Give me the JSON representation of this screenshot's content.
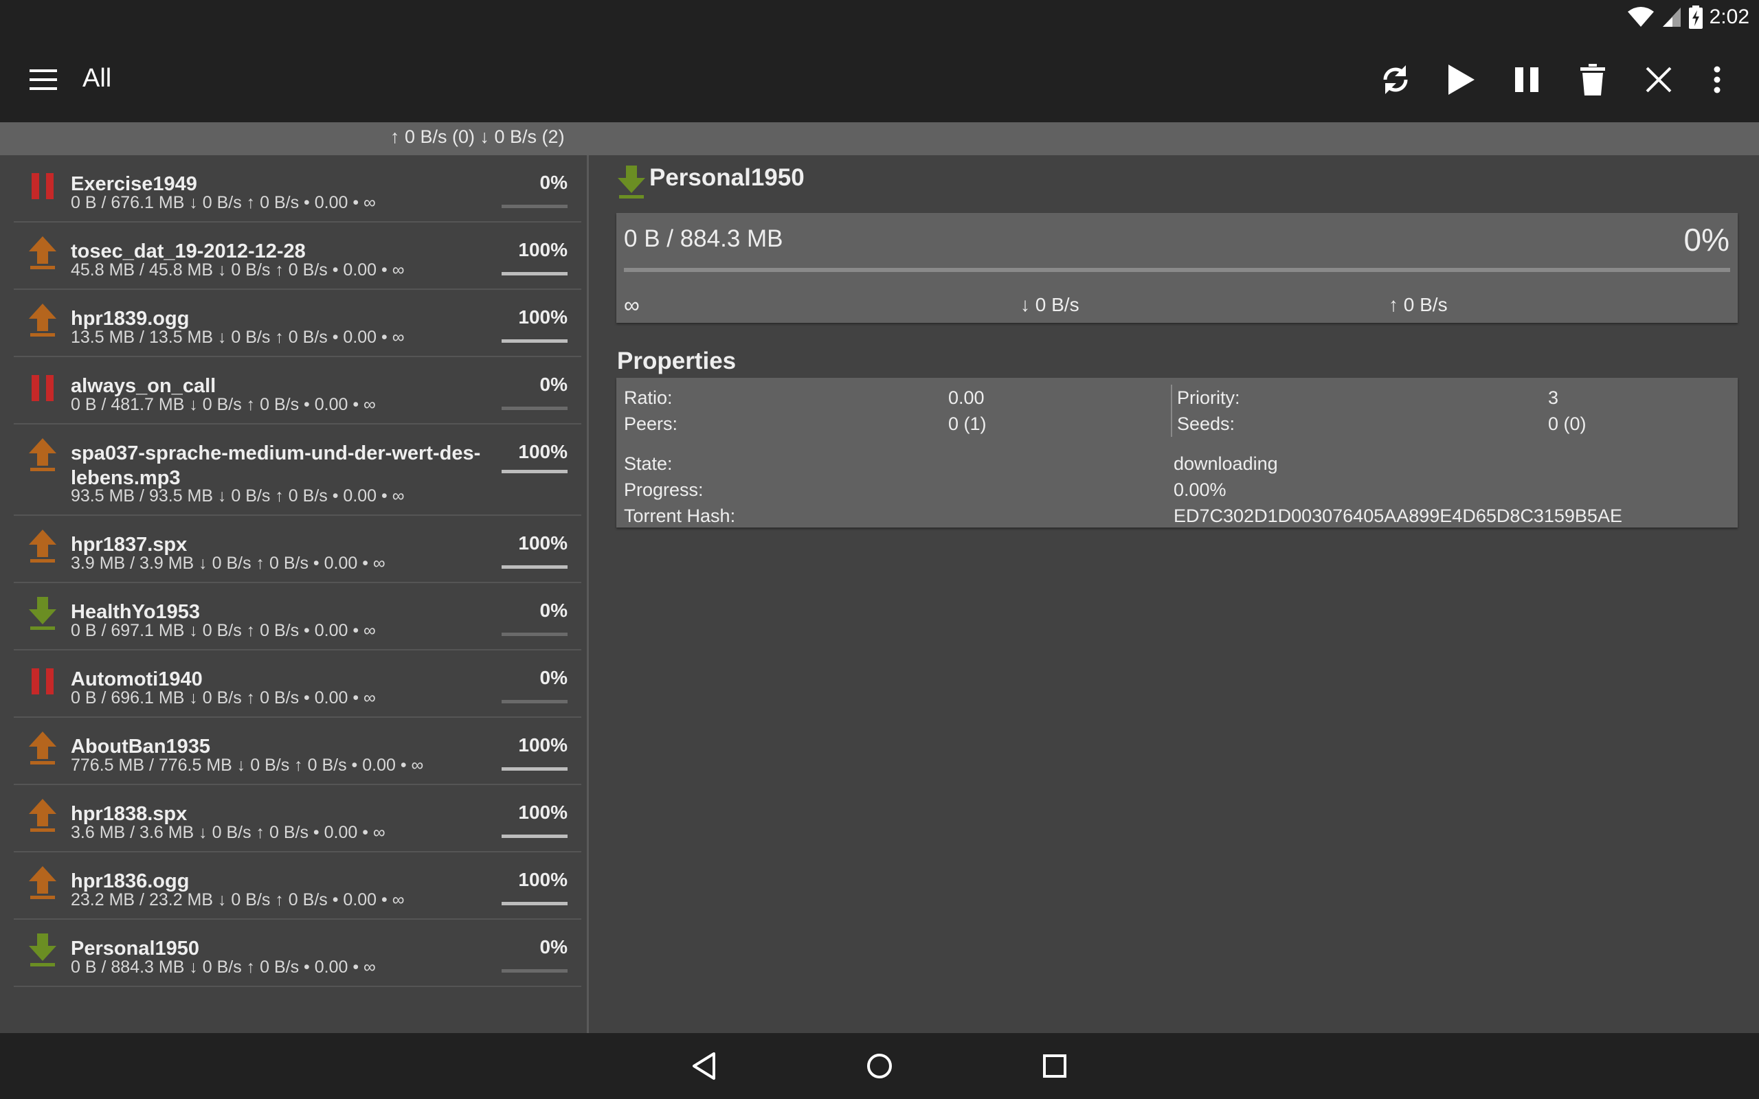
{
  "status": {
    "time": "2:02"
  },
  "toolbar": {
    "title": "All"
  },
  "speed": {
    "summary": "↑ 0 B/s (0) ↓ 0 B/s (2)"
  },
  "torrents": [
    {
      "name": "Exercise1949",
      "meta": "0 B / 676.1 MB ↓ 0 B/s ↑ 0 B/s • 0.00 • ∞",
      "percent": "0%",
      "progress": 0,
      "state": "paused"
    },
    {
      "name": "tosec_dat_19-2012-12-28",
      "meta": "45.8 MB / 45.8 MB ↓ 0 B/s ↑ 0 B/s • 0.00 • ∞",
      "percent": "100%",
      "progress": 100,
      "state": "seeding"
    },
    {
      "name": "hpr1839.ogg",
      "meta": "13.5 MB / 13.5 MB ↓ 0 B/s ↑ 0 B/s • 0.00 • ∞",
      "percent": "100%",
      "progress": 100,
      "state": "seeding"
    },
    {
      "name": "always_on_call",
      "meta": "0 B / 481.7 MB ↓ 0 B/s ↑ 0 B/s • 0.00 • ∞",
      "percent": "0%",
      "progress": 0,
      "state": "paused"
    },
    {
      "name": "spa037-sprache-medium-und-der-wert-des-lebens.mp3",
      "meta": "93.5 MB / 93.5 MB ↓ 0 B/s ↑ 0 B/s • 0.00 • ∞",
      "percent": "100%",
      "progress": 100,
      "state": "seeding"
    },
    {
      "name": "hpr1837.spx",
      "meta": "3.9 MB / 3.9 MB ↓ 0 B/s ↑ 0 B/s • 0.00 • ∞",
      "percent": "100%",
      "progress": 100,
      "state": "seeding"
    },
    {
      "name": "HealthYo1953",
      "meta": "0 B / 697.1 MB ↓ 0 B/s ↑ 0 B/s • 0.00 • ∞",
      "percent": "0%",
      "progress": 0,
      "state": "downloading"
    },
    {
      "name": "Automoti1940",
      "meta": "0 B / 696.1 MB ↓ 0 B/s ↑ 0 B/s • 0.00 • ∞",
      "percent": "0%",
      "progress": 0,
      "state": "paused"
    },
    {
      "name": "AboutBan1935",
      "meta": "776.5 MB / 776.5 MB ↓ 0 B/s ↑ 0 B/s • 0.00 • ∞",
      "percent": "100%",
      "progress": 100,
      "state": "seeding"
    },
    {
      "name": "hpr1838.spx",
      "meta": "3.6 MB / 3.6 MB ↓ 0 B/s ↑ 0 B/s • 0.00 • ∞",
      "percent": "100%",
      "progress": 100,
      "state": "seeding"
    },
    {
      "name": "hpr1836.ogg",
      "meta": "23.2 MB / 23.2 MB ↓ 0 B/s ↑ 0 B/s • 0.00 • ∞",
      "percent": "100%",
      "progress": 100,
      "state": "seeding"
    },
    {
      "name": "Personal1950",
      "meta": "0 B / 884.3 MB ↓ 0 B/s ↑ 0 B/s • 0.00 • ∞",
      "percent": "0%",
      "progress": 0,
      "state": "downloading"
    }
  ],
  "detail": {
    "name": "Personal1950",
    "size": "0 B / 884.3 MB",
    "percent": "0%",
    "progress": 0,
    "eta": "∞",
    "down": "↓ 0 B/s",
    "up": "↑ 0 B/s",
    "properties_title": "Properties",
    "ratio_label": "Ratio:",
    "ratio_value": "0.00",
    "peers_label": "Peers:",
    "peers_value": "0 (1)",
    "priority_label": "Priority:",
    "priority_value": "3",
    "seeds_label": "Seeds:",
    "seeds_value": "0 (0)",
    "state_label": "State:",
    "state_value": "downloading",
    "progress_label": "Progress:",
    "progress_value": "0.00%",
    "hash_label": "Torrent Hash:",
    "hash_value": "ED7C302D1D003076405AA899E4D65D8C3159B5AE"
  },
  "icons": {
    "paused": "pause-icon",
    "seeding": "upload-arrow-icon",
    "downloading": "download-arrow-icon"
  },
  "colors": {
    "paused": "#c62828",
    "seeding": "#b5651d",
    "downloading": "#6b8e23"
  }
}
